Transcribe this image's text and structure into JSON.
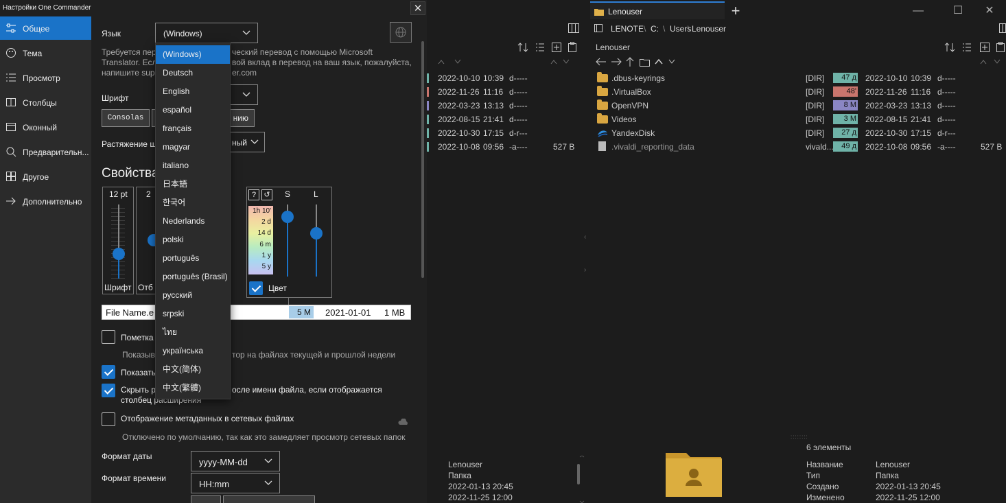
{
  "settings": {
    "title": "Настройки One Commander",
    "close": "✕",
    "sidebar": [
      {
        "label": "Общее",
        "icon": "sliders-icon",
        "active": true
      },
      {
        "label": "Тема",
        "icon": "palette-icon",
        "active": false
      },
      {
        "label": "Просмотр",
        "icon": "list-icon",
        "active": false
      },
      {
        "label": "Столбцы",
        "icon": "columns-icon",
        "active": false
      },
      {
        "label": "Оконный",
        "icon": "window-icon",
        "active": false
      },
      {
        "label": "Предварительн...",
        "icon": "preview-icon",
        "active": false
      },
      {
        "label": "Другое",
        "icon": "puzzle-icon",
        "active": false
      },
      {
        "label": "Дополнительно",
        "icon": "arrow-right-icon",
        "active": false
      }
    ],
    "language_label": "Язык",
    "language_value": "(Windows)",
    "translation_text": [
      "Требуется пер",
      "ческий перевод с помощью Microsoft",
      "Translator. Есл",
      "вой вклад в перевод на ваш язык, пожалуйста,",
      "напишите sup",
      "er.com"
    ],
    "font_label": "Шрифт",
    "font_button": "Consolas",
    "font_reset_button": "нию",
    "stretch_label": "Растяжение ш",
    "stretch_value": "ный",
    "section_heading": "Свойства",
    "font_size_value": "12 pt",
    "font_size_label": "Шрифт",
    "indent_value": "2",
    "indent_label": "Отб",
    "color_help": "?",
    "color_reset": "↺",
    "age_labels": [
      "1h 10'",
      "2 d",
      "14 d",
      "6 m",
      "1 y",
      "5 y"
    ],
    "s_label": "S",
    "l_label": "L",
    "color_label": "Цвет",
    "preview_name": "File Name.e",
    "preview_size_badge": "5 M",
    "preview_date": "2021-01-01",
    "preview_size": "1 MB",
    "option_mark_label": "Пометка",
    "option_mark_desc_a": "Показыв",
    "option_mark_desc_b": "тор на файлах текущей и прошлой недели",
    "option_show_label": "Показать",
    "option_hide_label_a": "Скрыть р",
    "option_hide_label_b": "осле имени файла, если отображается",
    "option_hide_label_c": "столбец расширения",
    "option_meta_label": "Отображение метаданных в сетевых файлах",
    "option_meta_desc": "Отключено по умолчанию, так как это замедляет просмотр сетевых папок",
    "date_format_label": "Формат даты",
    "date_format_value": "yyyy-MM-dd",
    "time_format_label": "Формат времени",
    "time_format_value": "HH:mm",
    "checks": {
      "mark": false,
      "show": true,
      "hide": true,
      "meta": false
    }
  },
  "language_dropdown": {
    "options": [
      "(Windows)",
      "Deutsch",
      "English",
      "español",
      "français",
      "magyar",
      "italiano",
      "日本語",
      "한국어",
      "Nederlands",
      "polski",
      "português",
      "português (Brasil)",
      "русский",
      "srpski",
      "ไทย",
      "українська",
      "中文(简体)",
      "中文(繁體)"
    ],
    "selected": 0
  },
  "file_manager": {
    "tab_title": "Lenouser",
    "new_tab": "+",
    "window_controls": [
      "—",
      "☐",
      "✕"
    ],
    "breadcrumb": [
      "LENOTE",
      "\\",
      "C:",
      "\\",
      "Users",
      "\\",
      "Lenouser"
    ],
    "panel_title": "Lenouser",
    "left_rows": [
      {
        "date": "2022-10-10",
        "time": "10:39",
        "attr": "d-----",
        "size": ""
      },
      {
        "date": "2022-11-26",
        "time": "11:16",
        "attr": "d-----",
        "size": ""
      },
      {
        "date": "2022-03-23",
        "time": "13:13",
        "attr": "d-----",
        "size": ""
      },
      {
        "date": "2022-08-15",
        "time": "21:41",
        "attr": "d-----",
        "size": ""
      },
      {
        "date": "2022-10-30",
        "time": "17:15",
        "attr": "d-r---",
        "size": ""
      },
      {
        "date": "2022-10-08",
        "time": "09:56",
        "attr": "-a----",
        "size": "527 B"
      }
    ],
    "right_rows": [
      {
        "name": ".dbus-keyrings",
        "type": "[DIR]",
        "age": "47 д",
        "age_color": "#6fb3a8",
        "date": "2022-10-10",
        "time": "10:39",
        "attr": "d-----",
        "size": ""
      },
      {
        "name": ".VirtualBox",
        "type": "[DIR]",
        "age": "48'",
        "age_color": "#c9756d",
        "date": "2022-11-26",
        "time": "11:16",
        "attr": "d-----",
        "size": ""
      },
      {
        "name": "OpenVPN",
        "type": "[DIR]",
        "age": "8 M",
        "age_color": "#8a86c4",
        "date": "2022-03-23",
        "time": "13:13",
        "attr": "d-----",
        "size": ""
      },
      {
        "name": "Videos",
        "type": "[DIR]",
        "age": "3 M",
        "age_color": "#6fb3a8",
        "date": "2022-08-15",
        "time": "21:41",
        "attr": "d-----",
        "size": ""
      },
      {
        "name": "YandexDisk",
        "type": "[DIR]",
        "age": "27 д",
        "age_color": "#6fb3a8",
        "date": "2022-10-30",
        "time": "17:15",
        "attr": "d-r---",
        "size": ""
      },
      {
        "name": ".vivaldi_reporting_data",
        "type": "vivald...",
        "age": "49 д",
        "age_color": "#6fb3a8",
        "date": "2022-10-08",
        "time": "09:56",
        "attr": "-a----",
        "size": "527 B"
      }
    ],
    "left_info": {
      "name": "Lenouser",
      "type": "Папка",
      "created": "2022-01-13  20:45",
      "modified": "2022-11-25  12:00"
    },
    "item_count": "6 элементы",
    "info_labels": [
      "Название",
      "Тип",
      "Создано",
      "Изменено"
    ],
    "info_values": [
      "Lenouser",
      "Папка",
      "2022-01-13  20:45",
      "2022-11-25  12:00"
    ]
  }
}
